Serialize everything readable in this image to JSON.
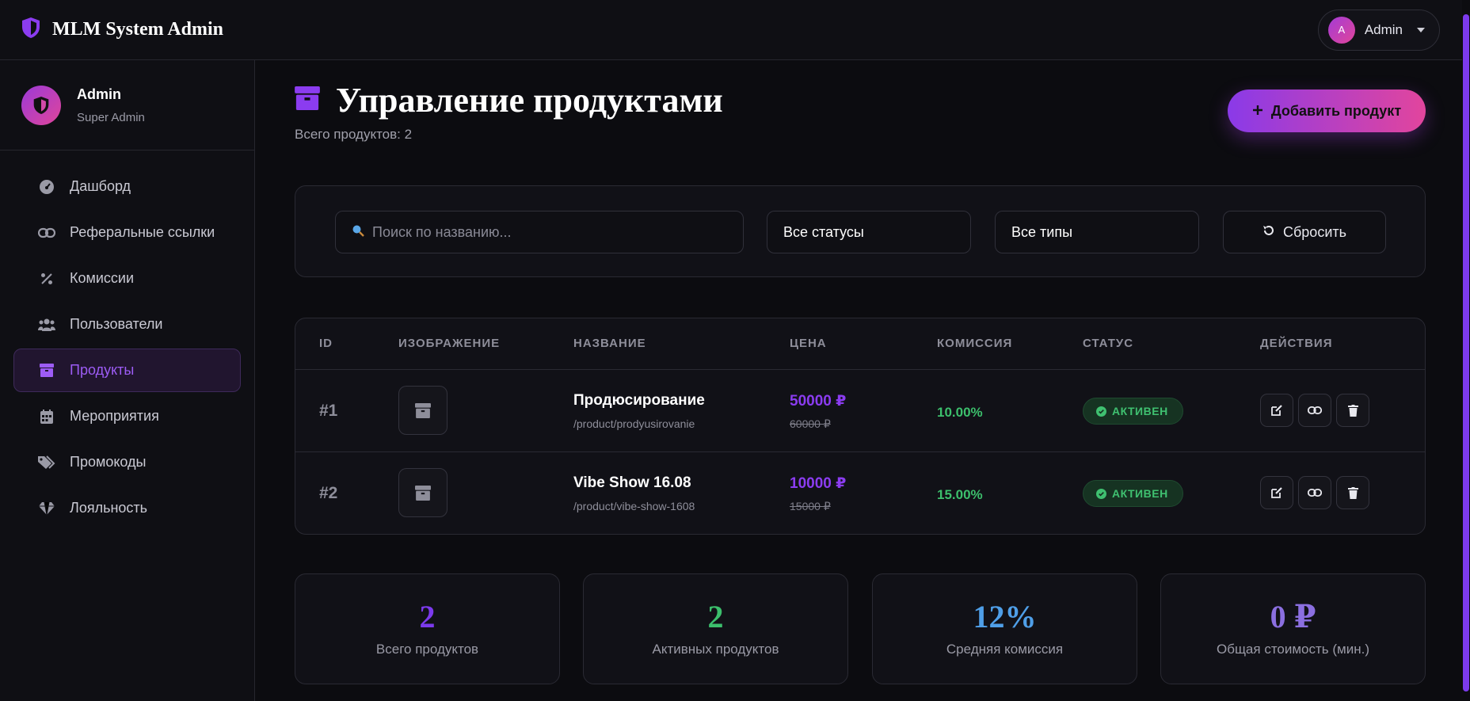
{
  "app": {
    "title": "MLM System Admin"
  },
  "topbar": {
    "user_initial": "A",
    "user_name": "Admin"
  },
  "sidebar": {
    "profile": {
      "name": "Admin",
      "role": "Super Admin"
    },
    "items": [
      {
        "label": "Дашборд",
        "icon": "gauge-icon"
      },
      {
        "label": "Реферальные ссылки",
        "icon": "link-icon"
      },
      {
        "label": "Комиссии",
        "icon": "percent-icon"
      },
      {
        "label": "Пользователи",
        "icon": "users-icon"
      },
      {
        "label": "Продукты",
        "icon": "box-icon",
        "active": true
      },
      {
        "label": "Мероприятия",
        "icon": "calendar-icon"
      },
      {
        "label": "Промокоды",
        "icon": "tags-icon"
      },
      {
        "label": "Лояльность",
        "icon": "gem-icon"
      }
    ]
  },
  "page": {
    "title": "Управление продуктами",
    "subtitle": "Всего продуктов: 2",
    "add_button": "Добавить продукт"
  },
  "filters": {
    "search_placeholder": "Поиск по названию...",
    "status_value": "Все статусы",
    "type_value": "Все типы",
    "reset_label": "Сбросить"
  },
  "table": {
    "headers": [
      "ID",
      "ИЗОБРАЖЕНИЕ",
      "НАЗВАНИЕ",
      "ЦЕНА",
      "КОМИССИЯ",
      "СТАТУС",
      "ДЕЙСТВИЯ"
    ],
    "rows": [
      {
        "id": "#1",
        "name": "Продюсирование",
        "slug": "/product/prodyusirovanie",
        "price": "50000 ₽",
        "old_price": "60000 ₽",
        "commission": "10.00%",
        "status": "АКТИВЕН"
      },
      {
        "id": "#2",
        "name": "Vibe Show 16.08",
        "slug": "/product/vibe-show-1608",
        "price": "10000 ₽",
        "old_price": "15000 ₽",
        "commission": "15.00%",
        "status": "АКТИВЕН"
      }
    ]
  },
  "stats": [
    {
      "value": "2",
      "label": "Всего продуктов",
      "color": "#7c3aed"
    },
    {
      "value": "2",
      "label": "Активных продуктов",
      "color": "#3cbf6c"
    },
    {
      "value": "12%",
      "label": "Средняя комиссия",
      "color": "#4f9fe8"
    },
    {
      "value": "0 ₽",
      "label": "Общая стоимость (мин.)",
      "color": "#8b6fe0"
    }
  ],
  "colors": {
    "accent": "#8b3cf0",
    "success": "#3cbf6c",
    "background": "#0c0c10"
  }
}
